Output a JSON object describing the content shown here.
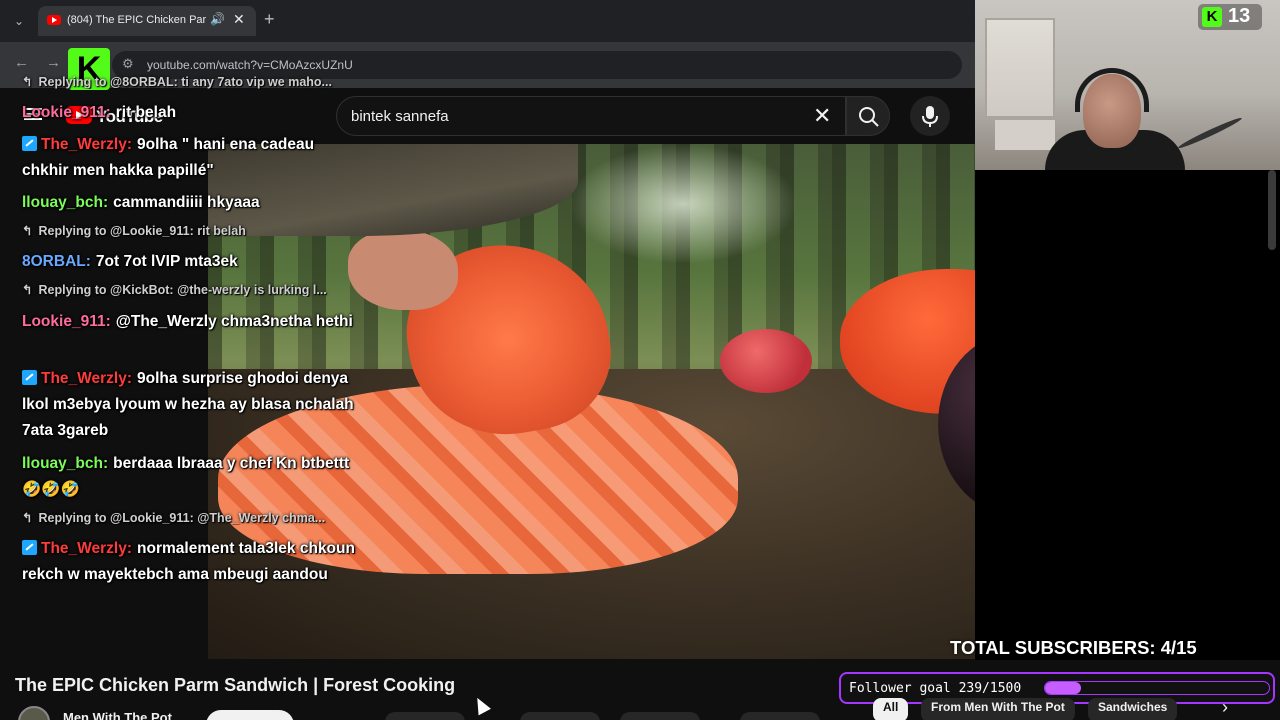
{
  "browser": {
    "tab_title": "(804) The EPIC Chicken Parm",
    "url": "youtube.com/watch?v=CMoAzcxUZnU"
  },
  "youtube": {
    "logo_text": "YouTube",
    "search_query": "bintek sannefa",
    "video_title": "The EPIC Chicken Parm Sandwich | Forest Cooking",
    "channel_name": "Men With The Pot",
    "chips": [
      "All",
      "From Men With The Pot",
      "Sandwiches"
    ]
  },
  "stream_overlay": {
    "kick_viewers": "13",
    "total_subscribers": "TOTAL SUBSCRIBERS: 4/15",
    "follower_goal_text": "Follower goal 239/1500",
    "follower_goal_progress": 0.159,
    "accent_color": "#53fc18",
    "goal_color": "#a436ff"
  },
  "chat": [
    {
      "type": "reply",
      "text": "Replying to @8ORBAL: ti any 7ato vip we maho..."
    },
    {
      "type": "msg",
      "user": "Lookie_911:",
      "color": "#ff6b9d",
      "badge": false,
      "text": "rit belah"
    },
    {
      "type": "msg",
      "user": "The_Werzly:",
      "color": "#ff3b3b",
      "badge": true,
      "text": "9olha \" hani ena cadeau chkhir men hakka papillé\""
    },
    {
      "type": "msg",
      "user": "llouay_bch:",
      "color": "#7cfc5a",
      "badge": false,
      "text": "cammandiiii hkyaaa"
    },
    {
      "type": "reply",
      "text": "Replying to @Lookie_911: rit belah"
    },
    {
      "type": "msg",
      "user": "8ORBAL:",
      "color": "#6aa8ff",
      "badge": false,
      "text": "7ot 7ot lVIP mta3ek"
    },
    {
      "type": "reply",
      "text": "Replying to @KickBot: @the-werzly is lurking l..."
    },
    {
      "type": "msg",
      "user": "Lookie_911:",
      "color": "#ff6b9d",
      "badge": false,
      "text": "@The_Werzly chma3netha hethi"
    },
    {
      "type": "msg",
      "user": "The_Werzly:",
      "color": "#ff3b3b",
      "badge": true,
      "text": "9olha surprise ghodoi denya lkol m3ebya lyoum w hezha ay blasa nchalah 7ata 3gareb"
    },
    {
      "type": "msg",
      "user": "llouay_bch:",
      "color": "#7cfc5a",
      "badge": false,
      "text": "berdaaa lbraaa y chef Kn btbettt 🤣🤣🤣"
    },
    {
      "type": "reply",
      "text": "Replying to @Lookie_911: @The_Werzly chma..."
    },
    {
      "type": "msg",
      "user": "The_Werzly:",
      "color": "#ff3b3b",
      "badge": true,
      "text": "normalement tala3lek chkoun rekch w mayektebch ama mbeugi aandou"
    }
  ]
}
